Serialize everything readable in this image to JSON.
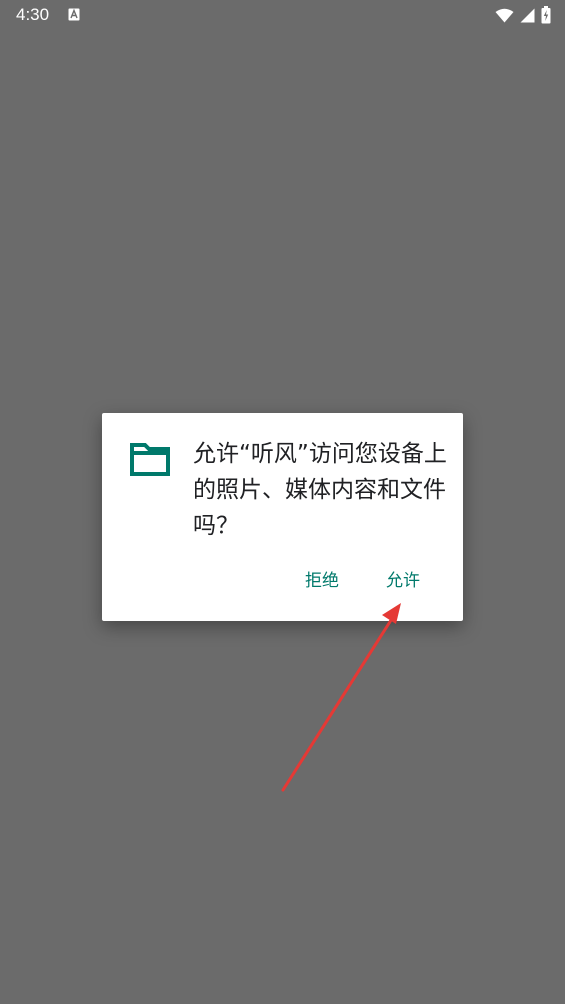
{
  "status_bar": {
    "time": "4:30",
    "notification_icon": "a-icon",
    "icons": [
      "wifi-icon",
      "signal-icon",
      "battery-charging-icon"
    ]
  },
  "dialog": {
    "icon": "folder-icon",
    "message": "允许“听风”访问您设备上的照片、媒体内容和文件吗？",
    "deny_label": "拒绝",
    "allow_label": "允许"
  },
  "colors": {
    "scrim": "#6b6b6b",
    "accent": "#00796b",
    "annotation_arrow": "#e53935"
  }
}
